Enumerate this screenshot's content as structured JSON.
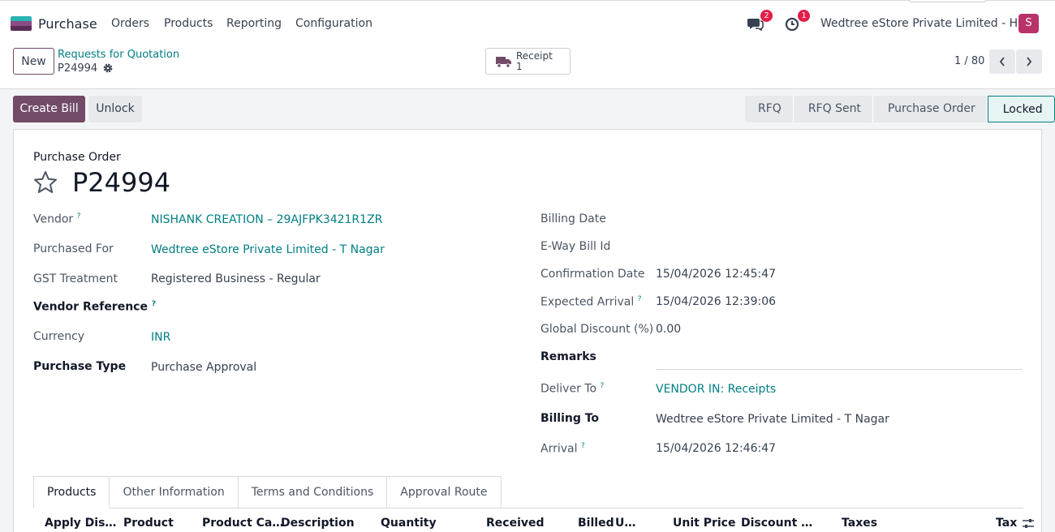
{
  "app": {
    "name": "Purchase",
    "icon": "purchase-app-icon"
  },
  "nav": [
    "Orders",
    "Products",
    "Reporting",
    "Configuration"
  ],
  "systray": {
    "messages_count": "2",
    "activities_count": "1",
    "company": "Wedtree eStore Private Limited - HO",
    "avatar_letter": "S"
  },
  "control": {
    "new_label": "New",
    "breadcrumb": "Requests for Quotation",
    "record": "P24994",
    "smart_button": {
      "label": "Receipt",
      "count": "1",
      "icon": "truck-icon"
    },
    "pager": "1 / 80"
  },
  "actions": {
    "primary": "Create Bill",
    "secondary": "Unlock"
  },
  "stages": [
    "RFQ",
    "RFQ Sent",
    "Purchase Order",
    "Locked"
  ],
  "active_stage": "Locked",
  "form": {
    "title_label": "Purchase Order",
    "name": "P24994",
    "left": {
      "vendor_label": "Vendor",
      "vendor_value": "NISHANK CREATION – 29AJFPK3421R1ZR",
      "purchased_for_label": "Purchased For",
      "purchased_for_value": "Wedtree eStore Private Limited - T Nagar",
      "gst_label": "GST Treatment",
      "gst_value": "Registered Business - Regular",
      "vendor_ref_label": "Vendor Reference",
      "currency_label": "Currency",
      "currency_value": "INR",
      "purchase_type_label": "Purchase Type",
      "purchase_type_value": "Purchase Approval"
    },
    "right": {
      "billing_date_label": "Billing Date",
      "eway_label": "E-Way Bill Id",
      "confirmation_label": "Confirmation Date",
      "confirmation_value": "15/04/2026 12:45:47",
      "expected_label": "Expected Arrival",
      "expected_value": "15/04/2026 12:39:06",
      "discount_label": "Global Discount (%)",
      "discount_value": "0.00",
      "remarks_label": "Remarks",
      "deliver_label": "Deliver To",
      "deliver_value": "VENDOR IN: Receipts",
      "billing_to_label": "Billing To",
      "billing_to_value": "Wedtree eStore Private Limited - T Nagar",
      "arrival_label": "Arrival",
      "arrival_value": "15/04/2026 12:46:47"
    },
    "help_mark": "?"
  },
  "tabs": [
    "Products",
    "Other Information",
    "Terms and Conditions",
    "Approval Route"
  ],
  "columns": [
    "Apply Dis…",
    "Product",
    "Product Ca…",
    "Description",
    "Quantity",
    "Received",
    "Billed",
    "U…",
    "Unit Price",
    "Discount …",
    "Taxes",
    "Tax"
  ]
}
